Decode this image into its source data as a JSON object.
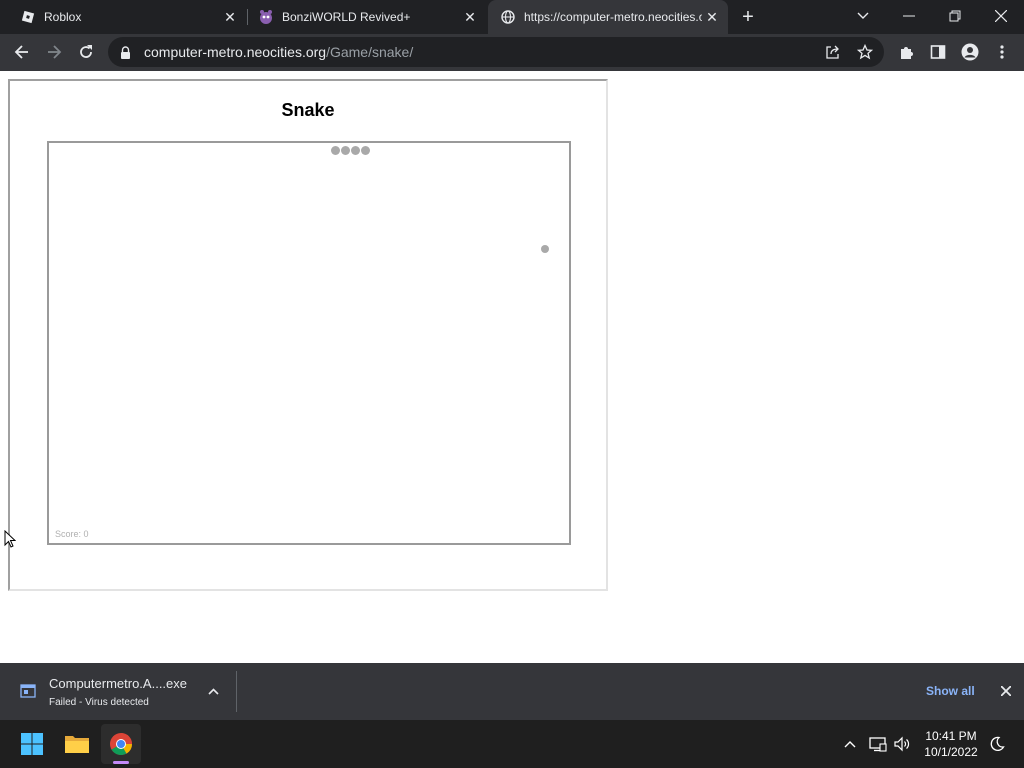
{
  "browser": {
    "tabs": [
      {
        "title": "Roblox",
        "favicon": "roblox-icon",
        "active": false
      },
      {
        "title": "BonziWORLD Revived+",
        "favicon": "bonzi-icon",
        "active": false
      },
      {
        "title": "https://computer-metro.neocities.org/Game/snake/",
        "favicon": "globe-icon",
        "active": true
      }
    ],
    "url_host": "computer-metro.neocities.org",
    "url_path": "/Game/snake/"
  },
  "page": {
    "title": "Snake",
    "score_label": "Score: 0"
  },
  "download": {
    "filename": "Computermetro.A....exe",
    "status": "Failed - Virus detected",
    "show_all": "Show all"
  },
  "taskbar": {
    "time": "10:41 PM",
    "date": "10/1/2022",
    "apps": [
      "start-icon",
      "file-explorer-icon",
      "chrome-icon"
    ]
  },
  "colors": {
    "frame_bg": "#202124",
    "toolbar_bg": "#35363a",
    "link_blue": "#8ab4f8",
    "snake_gray": "#a9a9a9"
  }
}
